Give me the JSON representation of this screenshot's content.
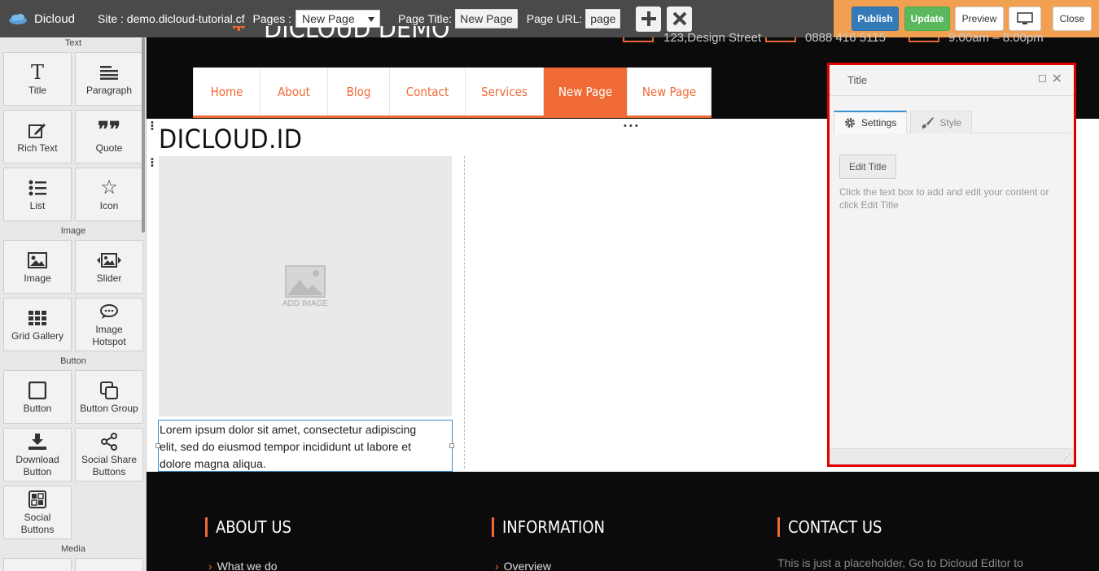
{
  "app": {
    "name": "Dicloud"
  },
  "toolbar": {
    "site_label": "Site : demo.dicloud-tutorial.cf",
    "pages_label": "Pages :",
    "pages_selected": "New Page",
    "page_title_label": "Page Title:",
    "page_title_value": "New Page",
    "page_url_label": "Page URL:",
    "page_url_value": "page",
    "add_icon": "plus-icon",
    "delete_icon": "close-icon",
    "publish": "Publish",
    "update": "Update",
    "preview": "Preview",
    "screen_icon": "monitor-icon",
    "close": "Close"
  },
  "sidebar": {
    "sections": {
      "text": "Text",
      "image": "Image",
      "button": "Button",
      "media": "Media"
    },
    "items": {
      "title": "Title",
      "paragraph": "Paragraph",
      "rich_text": "Rich Text",
      "quote": "Quote",
      "list": "List",
      "icon": "Icon",
      "image": "Image",
      "slider": "Slider",
      "grid_gallery": "Grid Gallery",
      "image_hotspot_1": "Image",
      "image_hotspot_2": "Hotspot",
      "button": "Button",
      "button_group": "Button Group",
      "download_1": "Download",
      "download_2": "Button",
      "social_share_1": "Social Share",
      "social_share_2": "Buttons",
      "social_1": "Social",
      "social_2": "Buttons"
    }
  },
  "site": {
    "header_partial": "DICLOUD DEMO",
    "address": "123,Design Street",
    "phone": "0888 416 5115",
    "hours": "9:00am – 8:00pm",
    "nav": [
      "Home",
      "About",
      "Blog",
      "Contact",
      "Services",
      "New Page",
      "New Page"
    ],
    "nav_active_index": 5,
    "page_heading": "DICLOUD.ID",
    "add_image": "ADD IMAGE",
    "lorem_1": "Lorem ipsum dolor sit amet, consectetur adipiscing",
    "lorem_2": "elit, sed do eiusmod tempor incididunt ut labore et",
    "lorem_3": "dolore magna aliqua.",
    "footer": {
      "about_title": "ABOUT US",
      "info_title": "INFORMATION",
      "contact_title": "CONTACT US",
      "about_link": "What we do",
      "info_link": "Overview",
      "contact_text": "This is just a placeholder, Go to Dicloud Editor to"
    }
  },
  "panel": {
    "title": "Title",
    "tab_settings": "Settings",
    "tab_style": "Style",
    "edit_button": "Edit Title",
    "help": "Click the text box to add and edit your content or click Edit Title"
  },
  "colors": {
    "accent": "#f06a35",
    "topbar": "#4a4a4a",
    "actions_bg": "#f0a050",
    "publish": "#337ab7",
    "update": "#5cb85c",
    "highlight": "#e00000"
  }
}
